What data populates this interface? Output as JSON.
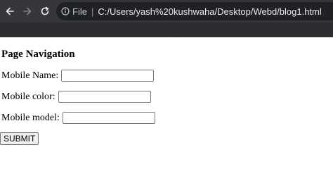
{
  "browser": {
    "file_label": "File",
    "url": "C:/Users/yash%20kushwaha/Desktop/Webd/blog1.html"
  },
  "page": {
    "heading": "Page Navigation",
    "fields": [
      {
        "label": "Mobile Name:",
        "value": ""
      },
      {
        "label": "Mobile color:",
        "value": ""
      },
      {
        "label": "Mobile model:",
        "value": ""
      }
    ],
    "submit_label": "SUBMIT"
  }
}
